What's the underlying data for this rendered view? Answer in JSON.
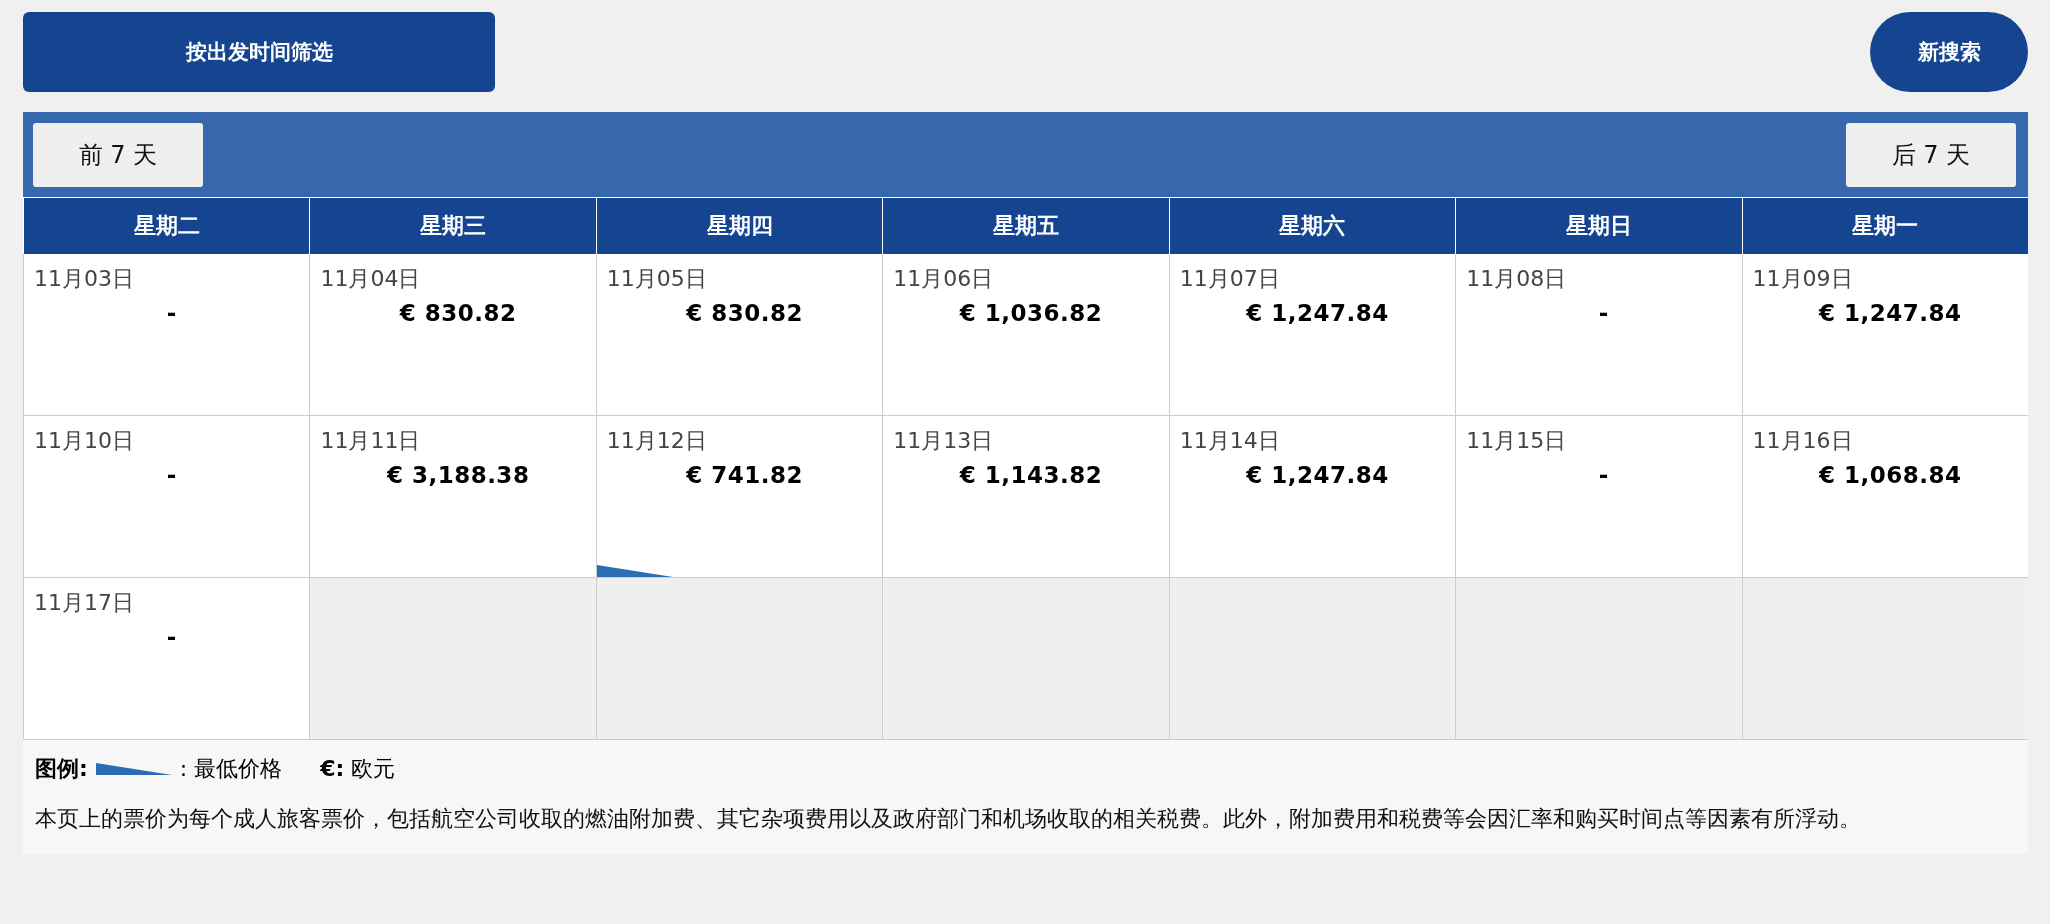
{
  "filter_button": "按出发时间筛选",
  "new_search_button": "新搜索",
  "nav": {
    "prev": "前 7 天",
    "next": "后 7 天"
  },
  "weekdays": [
    "星期二",
    "星期三",
    "星期四",
    "星期五",
    "星期六",
    "星期日",
    "星期一"
  ],
  "weeks": [
    [
      {
        "kind": "day",
        "date": "11月03日",
        "price": "-",
        "lowest": false
      },
      {
        "kind": "day",
        "date": "11月04日",
        "price": "€ 830.82",
        "lowest": false
      },
      {
        "kind": "day",
        "date": "11月05日",
        "price": "€ 830.82",
        "lowest": false
      },
      {
        "kind": "day",
        "date": "11月06日",
        "price": "€ 1,036.82",
        "lowest": false
      },
      {
        "kind": "day",
        "date": "11月07日",
        "price": "€ 1,247.84",
        "lowest": false
      },
      {
        "kind": "day",
        "date": "11月08日",
        "price": "-",
        "lowest": false
      },
      {
        "kind": "day",
        "date": "11月09日",
        "price": "€ 1,247.84",
        "lowest": false
      }
    ],
    [
      {
        "kind": "day",
        "date": "11月10日",
        "price": "-",
        "lowest": false
      },
      {
        "kind": "day",
        "date": "11月11日",
        "price": "€ 3,188.38",
        "lowest": false
      },
      {
        "kind": "day",
        "date": "11月12日",
        "price": "€ 741.82",
        "lowest": true
      },
      {
        "kind": "day",
        "date": "11月13日",
        "price": "€ 1,143.82",
        "lowest": false
      },
      {
        "kind": "day",
        "date": "11月14日",
        "price": "€ 1,247.84",
        "lowest": false
      },
      {
        "kind": "day",
        "date": "11月15日",
        "price": "-",
        "lowest": false
      },
      {
        "kind": "day",
        "date": "11月16日",
        "price": "€ 1,068.84",
        "lowest": false
      }
    ],
    [
      {
        "kind": "day",
        "date": "11月17日",
        "price": "-",
        "lowest": false
      },
      {
        "kind": "empty"
      },
      {
        "kind": "empty"
      },
      {
        "kind": "empty"
      },
      {
        "kind": "empty"
      },
      {
        "kind": "empty"
      },
      {
        "kind": "empty"
      }
    ]
  ],
  "legend": {
    "title": "图例:",
    "lowest_label": ": 最低价格",
    "currency": "**€:** 欧元"
  },
  "note": "本页上的票价为每个成人旅客票价，包括航空公司收取的燃油附加费、其它杂项费用以及政府部门和机场收取的相关税费。此外，附加费用和税费等会因汇率和购买时间点等因素有所浮动。"
}
